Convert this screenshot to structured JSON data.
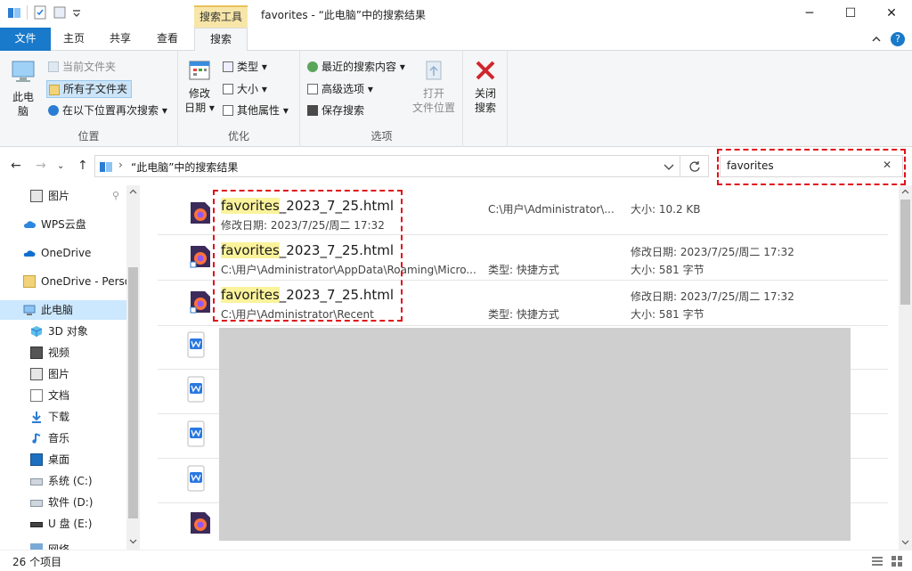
{
  "window": {
    "title": "favorites - “此电脑”中的搜索结果",
    "context_tab": "搜索工具",
    "minimize_icon": "─",
    "maximize_icon": "☐",
    "close_icon": "✕"
  },
  "tabs": [
    "文件",
    "主页",
    "共享",
    "查看",
    "搜索"
  ],
  "ribbon": {
    "location": {
      "this_pc": [
        "此电",
        "脑"
      ],
      "current_folder": "当前文件夹",
      "all_subfolders": "所有子文件夹",
      "search_again": "在以下位置再次搜索",
      "label": "位置"
    },
    "refine": {
      "date_modified": [
        "修改",
        "日期"
      ],
      "kind": "类型",
      "size": "大小",
      "other_props": "其他属性",
      "label": "优化"
    },
    "options": {
      "recent": "最近的搜索内容",
      "advanced": "高级选项",
      "save": "保存搜索",
      "open_location": [
        "打开",
        "文件位置"
      ],
      "close_search": [
        "关闭",
        "搜索"
      ],
      "label": "选项"
    }
  },
  "address": {
    "path": "“此电脑”中的搜索结果",
    "sep": "›"
  },
  "search": {
    "value": "favorites",
    "clear": "✕"
  },
  "nav_pane": [
    {
      "label": "图片",
      "icon": "pictures-icon"
    },
    {
      "label": "WPS云盘",
      "icon": "cloud-icon"
    },
    {
      "label": "OneDrive",
      "icon": "onedrive-icon"
    },
    {
      "label": "OneDrive - Perso",
      "icon": "folder-icon"
    },
    {
      "label": "此电脑",
      "icon": "computer-icon"
    },
    {
      "label": "3D 对象",
      "icon": "3d-icon"
    },
    {
      "label": "视频",
      "icon": "video-icon"
    },
    {
      "label": "图片",
      "icon": "pictures-icon"
    },
    {
      "label": "文档",
      "icon": "document-icon"
    },
    {
      "label": "下载",
      "icon": "download-icon"
    },
    {
      "label": "音乐",
      "icon": "music-icon"
    },
    {
      "label": "桌面",
      "icon": "desktop-icon"
    },
    {
      "label": "系统 (C:)",
      "icon": "drive-icon"
    },
    {
      "label": "软件 (D:)",
      "icon": "drive-icon"
    },
    {
      "label": "U 盘 (E:)",
      "icon": "drive-icon"
    },
    {
      "label": "网络",
      "icon": "network-icon"
    }
  ],
  "results": [
    {
      "name_hl": "favorites",
      "name_rest": "_2023_7_25.html",
      "line2": "修改日期: 2023/7/25/周二 17:32",
      "middle": "C:\\用户\\Administrator\\...",
      "right1": "大小: 10.2 KB",
      "right2": ""
    },
    {
      "name_hl": "favorites",
      "name_rest": "_2023_7_25.html",
      "line2": "C:\\用户\\Administrator\\AppData\\Roaming\\Micro...",
      "middle": "类型: 快捷方式",
      "right1": "修改日期: 2023/7/25/周二 17:32",
      "right2": "大小: 581 字节"
    },
    {
      "name_hl": "favorites",
      "name_rest": "_2023_7_25.html",
      "line2": "C:\\用户\\Administrator\\Recent",
      "middle": "类型: 快捷方式",
      "right1": "修改日期: 2023/7/25/周二 17:32",
      "right2": "大小: 581 字节"
    }
  ],
  "status": {
    "count": "26 个项目"
  },
  "colors": {
    "accent": "#1979ca",
    "highlight": "#fbf39c",
    "annotation_red": "#e0111b"
  }
}
